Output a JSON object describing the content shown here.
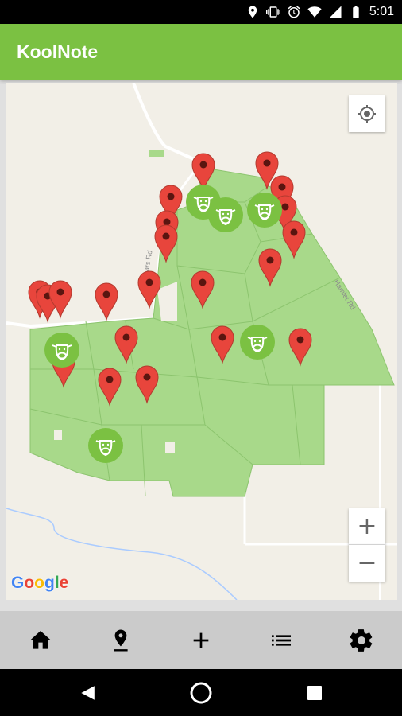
{
  "status_bar": {
    "time": "5:01",
    "icons": [
      "location-icon",
      "vibrate-icon",
      "alarm-icon",
      "wifi-icon",
      "signal-icon",
      "battery-icon"
    ]
  },
  "app_bar": {
    "title": "KoolNote",
    "color": "#7bc142"
  },
  "map": {
    "provider_logo": "Google",
    "road_labels": [
      "Kinnears Rd",
      "Hamlet Rd"
    ],
    "controls": {
      "locate": "my-location-icon",
      "zoom_in": "+",
      "zoom_out": "−"
    },
    "marker_color": "#e8453c",
    "field_color": "#a8d98a",
    "livestock_marker_color": "#7bc142"
  },
  "bottom_nav": {
    "items": [
      {
        "name": "home",
        "icon": "home-icon"
      },
      {
        "name": "map-pin",
        "icon": "pin-drop-icon"
      },
      {
        "name": "add",
        "icon": "plus-icon"
      },
      {
        "name": "list",
        "icon": "list-icon"
      },
      {
        "name": "settings",
        "icon": "gear-icon"
      }
    ]
  },
  "system_nav": {
    "items": [
      "back-icon",
      "home-circle-icon",
      "recents-icon"
    ]
  }
}
